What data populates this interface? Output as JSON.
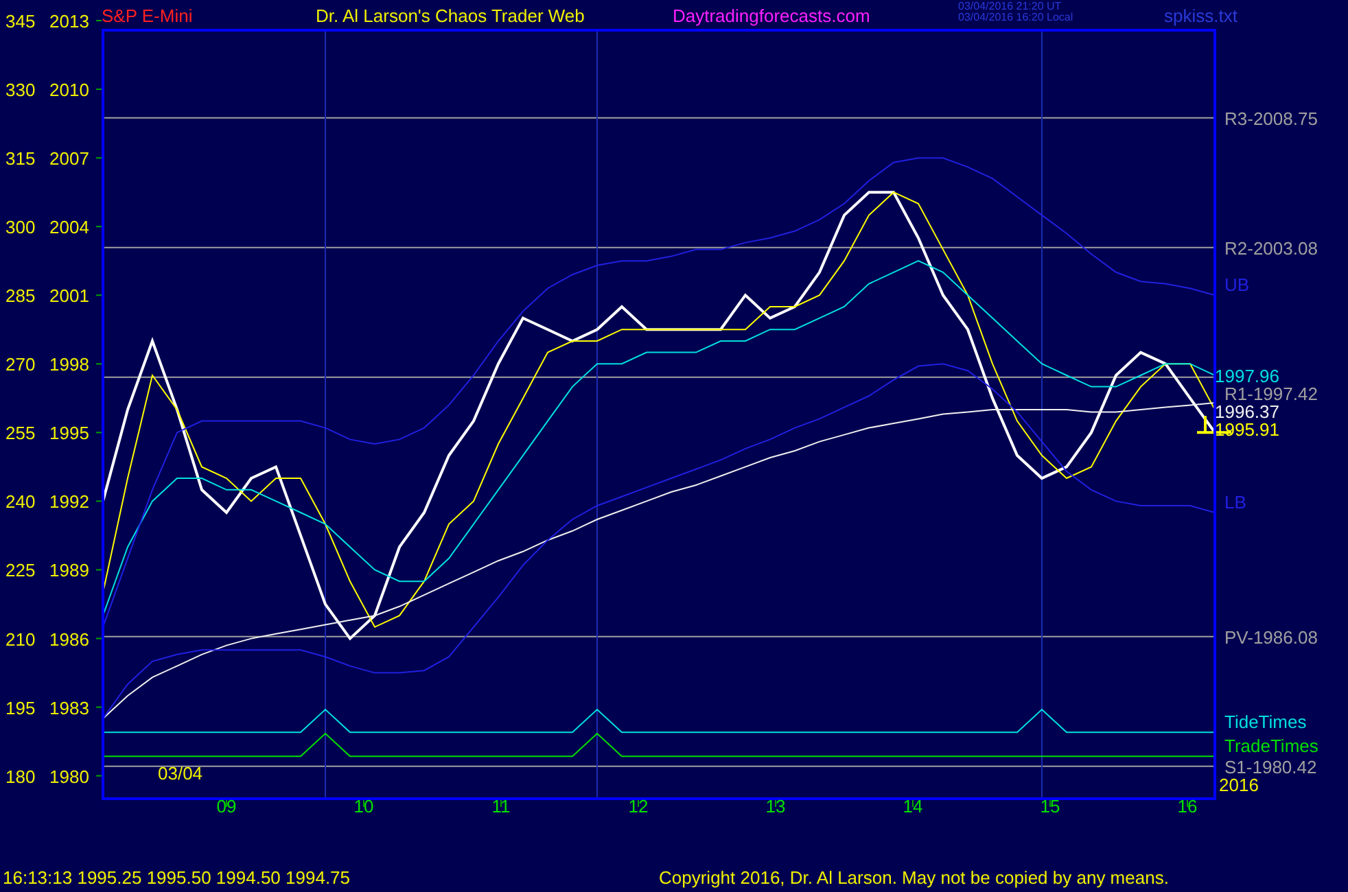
{
  "header": {
    "instrument": "S&P E-Mini",
    "title": "Dr. Al Larson's Chaos Trader Web",
    "site": "Daytradingforecasts.com",
    "timestamps": [
      "03/04/2016 21:20 UT",
      "03/04/2016 16:20 Local"
    ],
    "file": "spkiss.txt"
  },
  "secondary_axis": [
    "345",
    "330",
    "315",
    "300",
    "285",
    "270",
    "255",
    "240",
    "225",
    "210",
    "195",
    "180"
  ],
  "date_label": "03/04",
  "year_label": "2016",
  "chart_data": {
    "type": "line",
    "xlim": [
      8.1,
      16.2
    ],
    "ylim": [
      1979,
      2013
    ],
    "x": [
      8.1,
      8.28,
      8.46,
      8.64,
      8.82,
      9.0,
      9.18,
      9.36,
      9.54,
      9.72,
      9.9,
      10.08,
      10.26,
      10.44,
      10.62,
      10.8,
      10.98,
      11.16,
      11.34,
      11.52,
      11.7,
      11.88,
      12.06,
      12.24,
      12.42,
      12.6,
      12.78,
      12.96,
      13.14,
      13.32,
      13.5,
      13.68,
      13.86,
      14.04,
      14.22,
      14.4,
      14.58,
      14.76,
      14.94,
      15.12,
      15.3,
      15.48,
      15.66,
      15.84,
      16.02,
      16.2
    ],
    "xticks": [
      {
        "value": 9,
        "label": "09"
      },
      {
        "value": 10,
        "label": "10"
      },
      {
        "value": 11,
        "label": "11"
      },
      {
        "value": 12,
        "label": "12"
      },
      {
        "value": 13,
        "label": "13"
      },
      {
        "value": 14,
        "label": "14"
      },
      {
        "value": 15,
        "label": "15"
      },
      {
        "value": 16,
        "label": "16"
      }
    ],
    "yticks": [
      {
        "value": 2013,
        "label": "2013"
      },
      {
        "value": 2010,
        "label": "2010"
      },
      {
        "value": 2007,
        "label": "2007"
      },
      {
        "value": 2004,
        "label": "2004"
      },
      {
        "value": 2001,
        "label": "2001"
      },
      {
        "value": 1998,
        "label": "1998"
      },
      {
        "value": 1995,
        "label": "1995"
      },
      {
        "value": 1992,
        "label": "1992"
      },
      {
        "value": 1989,
        "label": "1989"
      },
      {
        "value": 1986,
        "label": "1986"
      },
      {
        "value": 1983,
        "label": "1983"
      },
      {
        "value": 1980,
        "label": "1980"
      }
    ],
    "series": [
      {
        "color": "#ffffff",
        "values": [
          1992,
          1996,
          1999,
          1996,
          1992.5,
          1991.5,
          1993,
          1993.5,
          1990.5,
          1987.5,
          1986,
          1987,
          1990,
          1991.5,
          1994,
          1995.5,
          1998,
          2000,
          1999.5,
          1999,
          1999.5,
          2000.5,
          1999.5,
          1999.5,
          1999.5,
          1999.5,
          2001,
          2000,
          2000.5,
          2002,
          2004.5,
          2005.5,
          2005.5,
          2003.5,
          2001,
          1999.5,
          1996.5,
          1994,
          1993,
          1993.5,
          1995,
          1997.5,
          1998.5,
          1998,
          1996.5,
          1995
        ]
      },
      {
        "color": "#ffff00",
        "values": [
          1988,
          1993,
          1997.5,
          1996,
          1993.5,
          1993,
          1992,
          1993,
          1993,
          1991,
          1988.5,
          1986.5,
          1987,
          1988.5,
          1991,
          1992,
          1994.5,
          1996.5,
          1998.5,
          1999,
          1999,
          1999.5,
          1999.5,
          1999.5,
          1999.5,
          1999.5,
          1999.5,
          2000.5,
          2000.5,
          2001,
          2002.5,
          2004.5,
          2005.5,
          2005,
          2003,
          2001,
          1998,
          1995.5,
          1994,
          1993,
          1993.5,
          1995.5,
          1997,
          1998,
          1998,
          1996
        ]
      },
      {
        "color": "#00e0e0",
        "values": [
          1987,
          1990,
          1992,
          1993,
          1993,
          1992.5,
          1992.5,
          1992,
          1991.5,
          1991,
          1990,
          1989,
          1988.5,
          1988.5,
          1989.5,
          1991,
          1992.5,
          1994,
          1995.5,
          1997,
          1998,
          1998,
          1998.5,
          1998.5,
          1998.5,
          1999,
          1999,
          1999.5,
          1999.5,
          2000,
          2000.5,
          2001.5,
          2002,
          2002.5,
          2002,
          2001,
          2000,
          1999,
          1998,
          1997.5,
          1997,
          1997,
          1997.5,
          1998,
          1998,
          1997.5
        ]
      },
      {
        "color": "#f0f0f0",
        "values": [
          1982.5,
          1983.5,
          1984.3,
          1984.8,
          1985.3,
          1985.7,
          1986,
          1986.2,
          1986.4,
          1986.6,
          1986.8,
          1987,
          1987.4,
          1987.9,
          1988.4,
          1988.9,
          1989.4,
          1989.8,
          1990.3,
          1990.7,
          1991.2,
          1991.6,
          1992,
          1992.4,
          1992.7,
          1993.1,
          1993.5,
          1993.9,
          1994.2,
          1994.6,
          1994.9,
          1995.2,
          1995.4,
          1995.6,
          1995.8,
          1995.9,
          1996,
          1996,
          1996,
          1996,
          1995.9,
          1995.9,
          1996,
          1996.1,
          1996.2,
          1996.3
        ]
      },
      {
        "name": "UB",
        "color": "#2020e0",
        "values": [
          1986.5,
          1989.5,
          1992.5,
          1995,
          1995.5,
          1995.5,
          1995.5,
          1995.5,
          1995.5,
          1995.2,
          1994.7,
          1994.5,
          1994.7,
          1995.2,
          1996.2,
          1997.5,
          1999,
          2000.3,
          2001.3,
          2001.9,
          2002.3,
          2002.5,
          2002.5,
          2002.7,
          2003,
          2003,
          2003.3,
          2003.5,
          2003.8,
          2004.3,
          2005,
          2006,
          2006.8,
          2007,
          2007,
          2006.6,
          2006.1,
          2005.3,
          2004.5,
          2003.7,
          2002.8,
          2002,
          2001.6,
          2001.5,
          2001.3,
          2001
        ]
      },
      {
        "name": "LB",
        "color": "#2020e0",
        "values": [
          1982.5,
          1984,
          1985,
          1985.3,
          1985.5,
          1985.5,
          1985.5,
          1985.5,
          1985.5,
          1985.2,
          1984.8,
          1984.5,
          1984.5,
          1984.6,
          1985.2,
          1986.5,
          1987.8,
          1989.2,
          1990.3,
          1991.2,
          1991.8,
          1992.2,
          1992.6,
          1993,
          1993.4,
          1993.8,
          1994.3,
          1994.7,
          1995.2,
          1995.6,
          1996.1,
          1996.6,
          1997.3,
          1997.9,
          1998,
          1997.7,
          1996.9,
          1995.9,
          1994.6,
          1993.3,
          1992.5,
          1992,
          1991.8,
          1991.8,
          1991.8,
          1991.5
        ]
      },
      {
        "name": "TideTimes",
        "color": "#00e0e0",
        "values": [
          1981.9,
          1981.9,
          1981.9,
          1981.9,
          1981.9,
          1981.9,
          1981.9,
          1981.9,
          1981.9,
          1982.9,
          1981.9,
          1981.9,
          1981.9,
          1981.9,
          1981.9,
          1981.9,
          1981.9,
          1981.9,
          1981.9,
          1981.9,
          1982.9,
          1981.9,
          1981.9,
          1981.9,
          1981.9,
          1981.9,
          1981.9,
          1981.9,
          1981.9,
          1981.9,
          1981.9,
          1981.9,
          1981.9,
          1981.9,
          1981.9,
          1981.9,
          1981.9,
          1981.9,
          1982.9,
          1981.9,
          1981.9,
          1981.9,
          1981.9,
          1981.9,
          1981.9,
          1981.9
        ]
      },
      {
        "name": "TradeTimes",
        "color": "#00e000",
        "values": [
          1980.85,
          1980.85,
          1980.85,
          1980.85,
          1980.85,
          1980.85,
          1980.85,
          1980.85,
          1980.85,
          1981.85,
          1980.85,
          1980.85,
          1980.85,
          1980.85,
          1980.85,
          1980.85,
          1980.85,
          1980.85,
          1980.85,
          1980.85,
          1981.85,
          1980.85,
          1980.85,
          1980.85,
          1980.85,
          1980.85,
          1980.85,
          1980.85,
          1980.85,
          1980.85,
          1980.85,
          1980.85,
          1980.85,
          1980.85,
          1980.85,
          1980.85,
          1980.85,
          1980.85,
          1980.85,
          1980.85,
          1980.85,
          1980.85,
          1980.85,
          1980.85,
          1980.85,
          1980.85
        ]
      }
    ],
    "ref_lines": [
      {
        "axis": "y",
        "value": 2008.75,
        "label": "R3-2008.75"
      },
      {
        "axis": "y",
        "value": 2003.08,
        "label": "R2-2003.08"
      },
      {
        "axis": "y",
        "value": 1997.42,
        "label": "R1-1997.42"
      },
      {
        "axis": "y",
        "value": 1986.08,
        "label": "PV-1986.08"
      },
      {
        "axis": "y",
        "value": 1980.42,
        "label": "S1-1980.42"
      },
      {
        "axis": "x",
        "value": 9.72
      },
      {
        "axis": "x",
        "value": 11.7
      },
      {
        "axis": "x",
        "value": 14.94
      }
    ],
    "annotations": [
      "1995.91",
      "1997.96",
      "1996.37"
    ]
  },
  "status": {
    "quote": "16:13:13  1995.25 1995.50 1994.50 1994.75",
    "copyright": "Copyright 2016, Dr. Al Larson. May not be copied by any means."
  }
}
